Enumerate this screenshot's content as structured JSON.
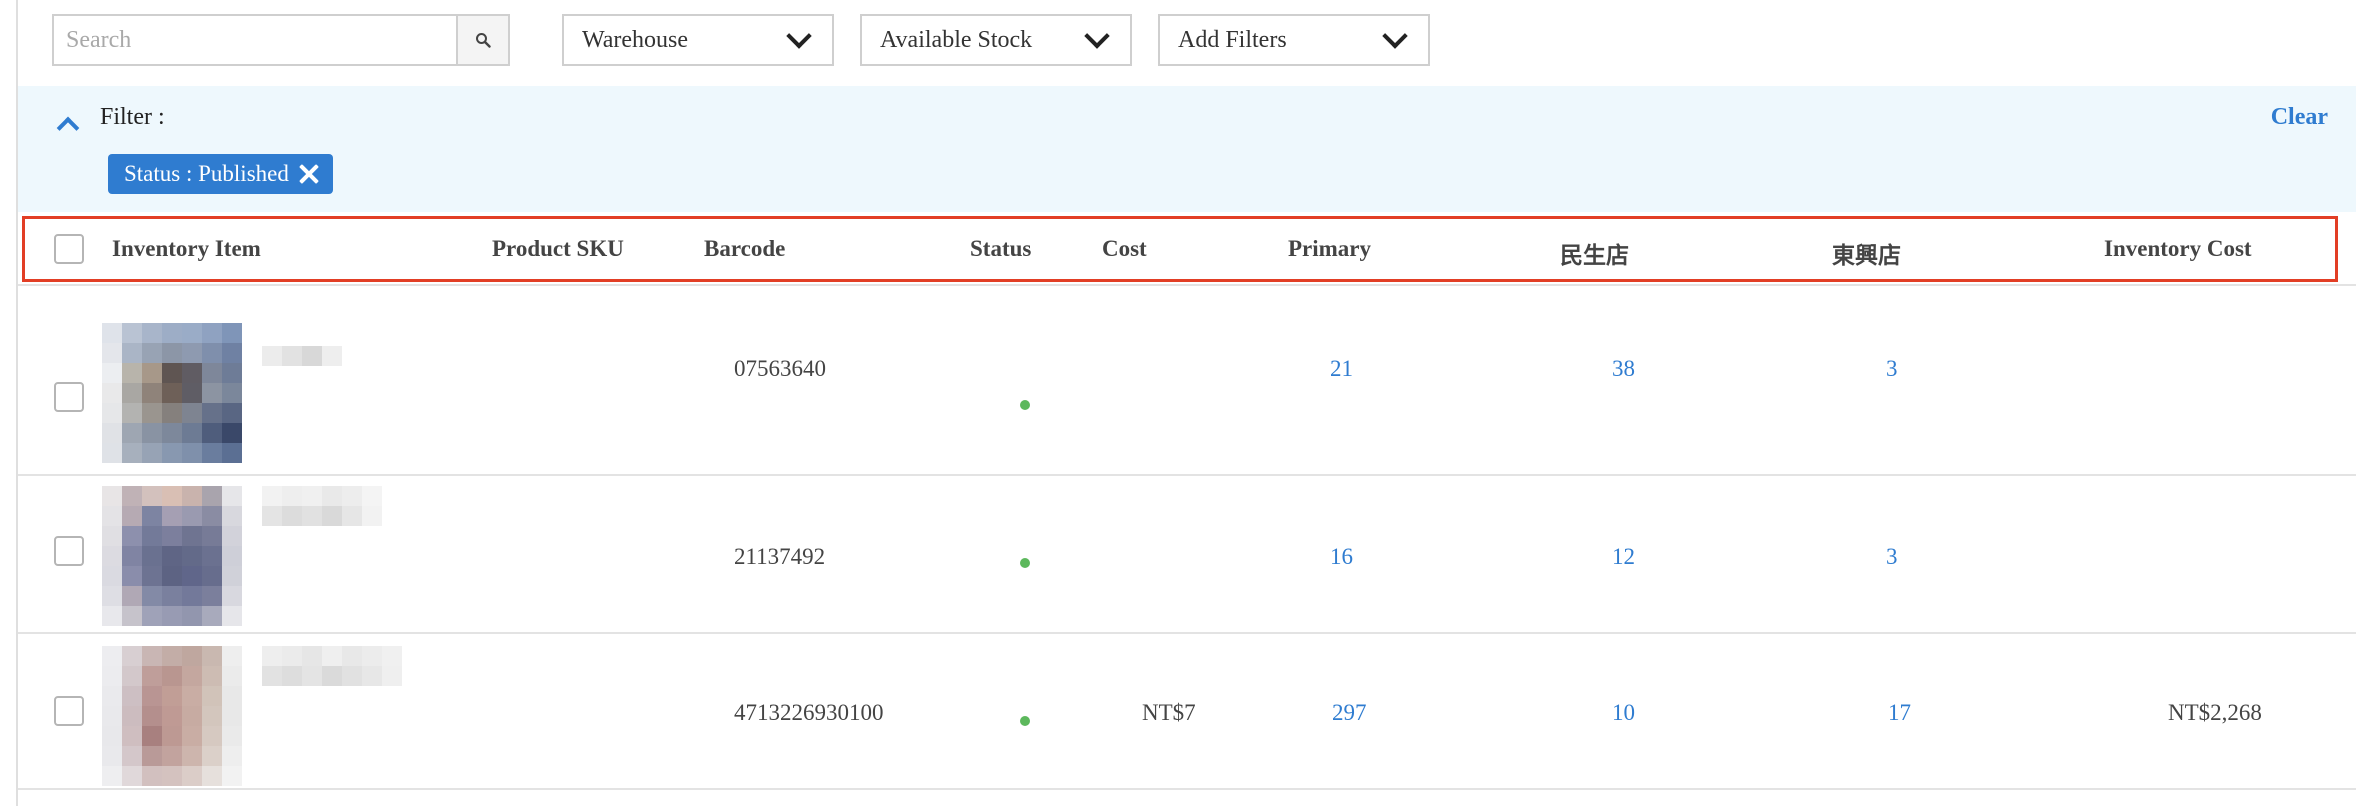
{
  "toolbar": {
    "search_placeholder": "Search",
    "search_icon": "search-icon",
    "warehouse_label": "Warehouse",
    "available_stock_label": "Available Stock",
    "add_filters_label": "Add Filters"
  },
  "filter": {
    "label": "Filter :",
    "clear_label": "Clear",
    "chips": [
      {
        "text": "Status : Published"
      }
    ]
  },
  "table": {
    "headers": {
      "inventory_item": "Inventory Item",
      "product_sku": "Product SKU",
      "barcode": "Barcode",
      "status": "Status",
      "cost": "Cost",
      "primary": "Primary",
      "store1": "民生店",
      "store2": "東興店",
      "inventory_cost": "Inventory Cost"
    },
    "rows": [
      {
        "barcode": "07563640",
        "status": "published",
        "cost": "",
        "primary": "21",
        "store1": "38",
        "store2": "3",
        "inventory_cost": ""
      },
      {
        "barcode": "21137492",
        "status": "published",
        "cost": "",
        "primary": "16",
        "store1": "12",
        "store2": "3",
        "inventory_cost": ""
      },
      {
        "barcode": "4713226930100",
        "status": "published",
        "cost": "NT$7",
        "primary": "297",
        "store1": "10",
        "store2": "17",
        "inventory_cost": "NT$2,268"
      }
    ]
  },
  "colors": {
    "accent": "#2f7cd0",
    "filter_panel_bg": "#eef8fd",
    "status_published": "#5cb85c",
    "highlight_outline": "#e23e25"
  }
}
